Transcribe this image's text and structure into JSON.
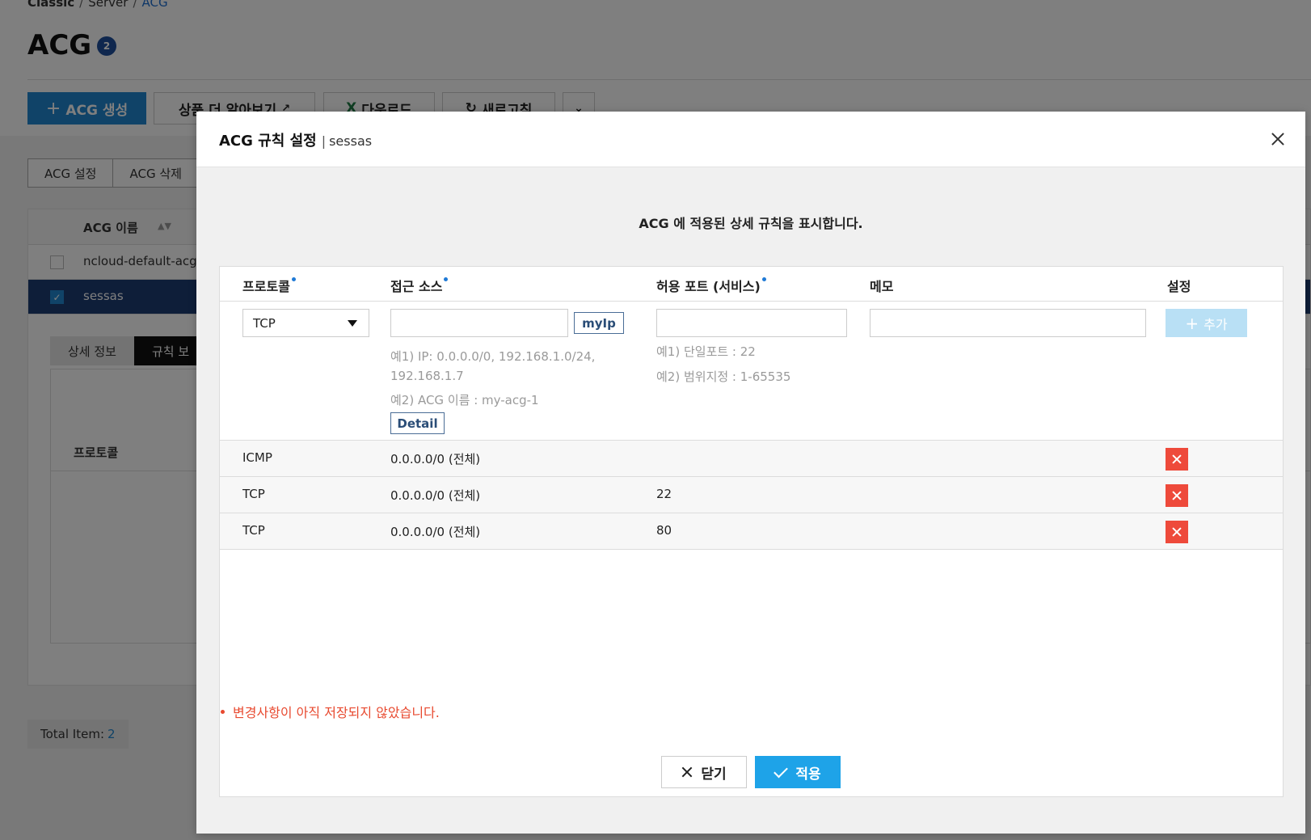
{
  "breadcrumb": {
    "items": [
      "Classic",
      "Server",
      "ACG"
    ],
    "separator": "/"
  },
  "page": {
    "title": "ACG",
    "count_badge": "2"
  },
  "toolbar": {
    "create_label": "ACG 생성",
    "learn_more_label": "상품 더 알아보기",
    "download_label": "다운로드",
    "refresh_label": "새로고침"
  },
  "actions": {
    "settings_label": "ACG 설정",
    "delete_label": "ACG 삭제"
  },
  "acg_table": {
    "header_name": "ACG 이름",
    "rows": [
      {
        "name": "ncloud-default-acg",
        "selected": false
      },
      {
        "name": "sessas",
        "selected": true
      }
    ]
  },
  "detail_tabs": {
    "info_label": "상세 정보",
    "rules_label": "규칙 보"
  },
  "detail_table": {
    "header_protocol": "프로토콜"
  },
  "total": {
    "label": "Total Item:",
    "count": "2"
  },
  "modal": {
    "title": "ACG 규칙 설정",
    "separator": "|",
    "subtitle": "sessas",
    "description": "ACG 에 적용된 상세 규칙을 표시합니다.",
    "columns": {
      "protocol": "프로토콜",
      "source": "접근 소스",
      "port": "허용 포트 (서비스)",
      "memo": "메모",
      "settings": "설정"
    },
    "input": {
      "protocol_value": "TCP",
      "source_value": "",
      "myip_label": "myIp",
      "source_hint_1": "예1) IP: 0.0.0.0/0, 192.168.1.0/24,",
      "source_hint_1b": "192.168.1.7",
      "source_hint_2": "예2) ACG 이름 : my-acg-1",
      "detail_label": "Detail",
      "port_value": "",
      "port_hint_1": "예1) 단일포트 : 22",
      "port_hint_2": "예2) 범위지정 : 1-65535",
      "memo_value": "",
      "add_label": "추가"
    },
    "rules": [
      {
        "protocol": "ICMP",
        "source": "0.0.0.0/0 (전체)",
        "port": ""
      },
      {
        "protocol": "TCP",
        "source": "0.0.0.0/0 (전체)",
        "port": "22"
      },
      {
        "protocol": "TCP",
        "source": "0.0.0.0/0 (전체)",
        "port": "80"
      }
    ],
    "warning": "변경사항이 아직 저장되지 않았습니다.",
    "close_label": "닫기",
    "apply_label": "적용"
  },
  "colors": {
    "primary": "#2186d0",
    "apply": "#1ea3e8",
    "danger": "#ee4a3b",
    "warning": "#e8492f",
    "selected_row": "#1d3c73"
  }
}
